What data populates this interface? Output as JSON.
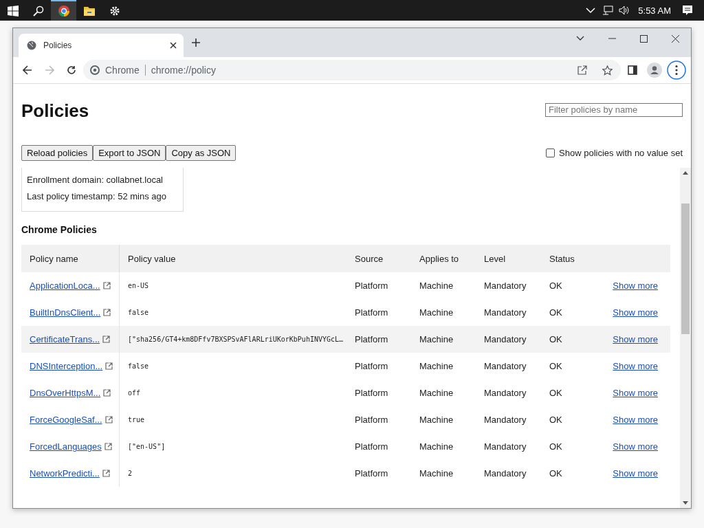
{
  "taskbar": {
    "clock": "5:53 AM",
    "apps": [
      {
        "kind": "chrome",
        "selected": true
      },
      {
        "kind": "folder",
        "selected": false
      },
      {
        "kind": "settings",
        "selected": false
      }
    ]
  },
  "window": {
    "tab": {
      "title": "Policies"
    },
    "address": {
      "site": "Chrome",
      "url": "chrome://policy"
    }
  },
  "page": {
    "title": "Policies",
    "filter": {
      "placeholder": "Filter policies by name"
    },
    "buttons": [
      "Reload policies",
      "Export to JSON",
      "Copy as JSON"
    ],
    "show_unset": {
      "label": "Show policies with no value set",
      "checked": false
    },
    "info": [
      "Enrollment domain: collabnet.local",
      "Last policy timestamp: 52 mins ago"
    ],
    "section_title": "Chrome Policies",
    "table": {
      "columns": [
        "Policy name",
        "Policy value",
        "Source",
        "Applies to",
        "Level",
        "Status"
      ],
      "rows": [
        {
          "name": "ApplicationLoca...",
          "value": "en-US",
          "source": "Platform",
          "applies_to": "Machine",
          "level": "Mandatory",
          "status": "OK",
          "action": "Show more",
          "highlighted": false
        },
        {
          "name": "BuiltInDnsClient...",
          "value": "false",
          "source": "Platform",
          "applies_to": "Machine",
          "level": "Mandatory",
          "status": "OK",
          "action": "Show more",
          "highlighted": false
        },
        {
          "name": "CertificateTrans...",
          "value": "[\"sha256/GT4+km8DFfv7BXSPSvAFlARLriUKorKbPuhINVYGcL…",
          "source": "Platform",
          "applies_to": "Machine",
          "level": "Mandatory",
          "status": "OK",
          "action": "Show more",
          "highlighted": true
        },
        {
          "name": "DNSInterception...",
          "value": "false",
          "source": "Platform",
          "applies_to": "Machine",
          "level": "Mandatory",
          "status": "OK",
          "action": "Show more",
          "highlighted": false
        },
        {
          "name": "DnsOverHttpsM...",
          "value": "off",
          "source": "Platform",
          "applies_to": "Machine",
          "level": "Mandatory",
          "status": "OK",
          "action": "Show more",
          "highlighted": false
        },
        {
          "name": "ForceGoogleSaf...",
          "value": "true",
          "source": "Platform",
          "applies_to": "Machine",
          "level": "Mandatory",
          "status": "OK",
          "action": "Show more",
          "highlighted": false
        },
        {
          "name": "ForcedLanguages",
          "value": "[\"en-US\"]",
          "source": "Platform",
          "applies_to": "Machine",
          "level": "Mandatory",
          "status": "OK",
          "action": "Show more",
          "highlighted": false
        },
        {
          "name": "NetworkPredicti...",
          "value": "2",
          "source": "Platform",
          "applies_to": "Machine",
          "level": "Mandatory",
          "status": "OK",
          "action": "Show more",
          "highlighted": false
        }
      ]
    }
  }
}
